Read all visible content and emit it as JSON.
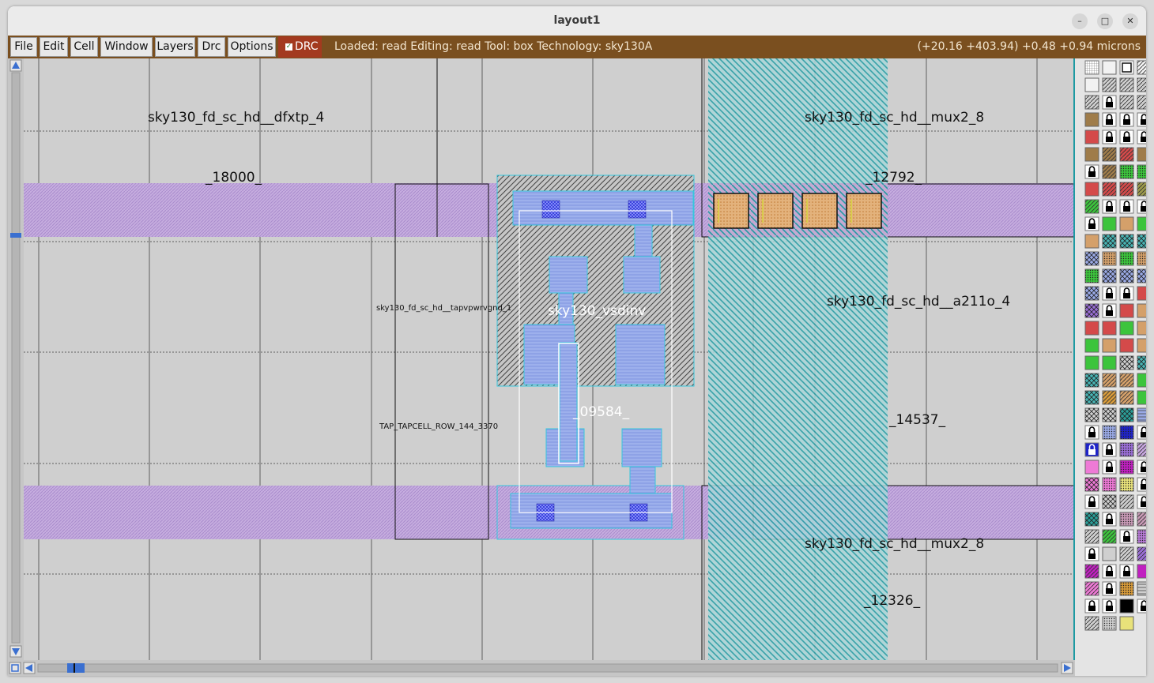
{
  "window": {
    "title": "layout1",
    "controls": [
      "–",
      "□",
      "✕"
    ]
  },
  "menu": {
    "items": [
      "File",
      "Edit",
      "Cell",
      "Window",
      "Layers",
      "Drc",
      "Options"
    ],
    "drc_toggle": "DRC"
  },
  "status": {
    "text": "Loaded: read Editing: read Tool: box  Technology: sky130A",
    "coords": "(+20.16 +403.94) +0.48 +0.94 microns"
  },
  "canvas": {
    "cell_labels": {
      "dfxtp": "sky130_fd_sc_hd__dfxtp_4",
      "inst_18000": "_18000_",
      "mux2_top": "sky130_fd_sc_hd__mux2_8",
      "inst_12792": "_12792_",
      "tapvpwr": "sky130_fd_sc_hd__tapvpwrvgnd_1",
      "vsdinv": "sky130_vsdinv",
      "a211o": "sky130_fd_sc_hd__a211o_4",
      "inst_09584": "_09584_",
      "tapcell": "TAP_TAPCELL_ROW_144_3370",
      "inst_14537": "_14537_",
      "mux2_bottom": "sky130_fd_sc_hd__mux2_8",
      "inst_12326": "_12326_"
    }
  },
  "palette": {
    "swatches": [
      [
        "grid",
        "white-solid",
        "box",
        "white-diag"
      ],
      [
        "white-solid",
        "gray-diag",
        "gray-diag",
        "gray-diag"
      ],
      [
        "gray-diag",
        "lock",
        "gray-diag",
        "gray-diag"
      ],
      [
        "brown-solid",
        "lock",
        "lock",
        "lock"
      ],
      [
        "red-solid",
        "lock",
        "lock",
        "lock"
      ],
      [
        "brown-solid",
        "brown-diag",
        "red-diag",
        "brown-solid"
      ],
      [
        "lock",
        "brown-diag",
        "green-dots",
        "green-dots"
      ],
      [
        "red-solid",
        "red-diag",
        "red-diag",
        "olive-diag"
      ],
      [
        "green-diag",
        "lock",
        "lock",
        "lock"
      ],
      [
        "lock",
        "green-solid",
        "tan-solid",
        "green-solid"
      ],
      [
        "tan-solid",
        "cyan-x",
        "cyan-x",
        "cyan-x"
      ],
      [
        "blue-x",
        "tan-dots",
        "green-dots",
        "tan-dots"
      ],
      [
        "green-dots",
        "blue-x",
        "blue-x",
        "blue-x"
      ],
      [
        "blue-x",
        "lock",
        "lock",
        "red-solid"
      ],
      [
        "purple-x",
        "lock",
        "red-solid",
        "tan-solid"
      ],
      [
        "red-solid",
        "red-solid",
        "green-solid",
        "tan-solid"
      ],
      [
        "green-solid",
        "tan-solid",
        "red-solid",
        "tan-solid"
      ],
      [
        "green-solid",
        "green-solid",
        "gray-x",
        "cyan-x"
      ],
      [
        "cyan-x",
        "tan-diag",
        "tan-diag",
        "green-solid"
      ],
      [
        "cyan-x",
        "orange-diag",
        "tan-diag",
        "green-solid"
      ],
      [
        "gray-x",
        "gray-x",
        "teal-x",
        "blue-lines"
      ],
      [
        "lock",
        "blue-dots",
        "navy-dots",
        "lock"
      ],
      [
        "navy-lock",
        "lock",
        "purple-dots",
        "lilac-diag"
      ],
      [
        "pink-solid",
        "lock",
        "magenta-dots",
        "lock"
      ],
      [
        "pink-x",
        "pink-dots",
        "yellow-dots",
        "lock"
      ],
      [
        "lock",
        "gray-x",
        "gray-diag",
        "lock"
      ],
      [
        "teal-x",
        "lock",
        "mauve-dots",
        "mauve-diag"
      ],
      [
        "gray-diag",
        "green-diag",
        "lock",
        "violet-dots"
      ],
      [
        "lock",
        "gray-solid",
        "gray-diag",
        "purple-diag"
      ],
      [
        "magenta-diag",
        "lock",
        "lock",
        "magenta-solid"
      ],
      [
        "pink-diag",
        "lock",
        "orange-dots",
        "gray-lines"
      ],
      [
        "lock",
        "lock",
        "black-solid",
        "lock"
      ],
      [
        "gray-diag",
        "gray-dots",
        "yellow-solid",
        ""
      ]
    ]
  }
}
